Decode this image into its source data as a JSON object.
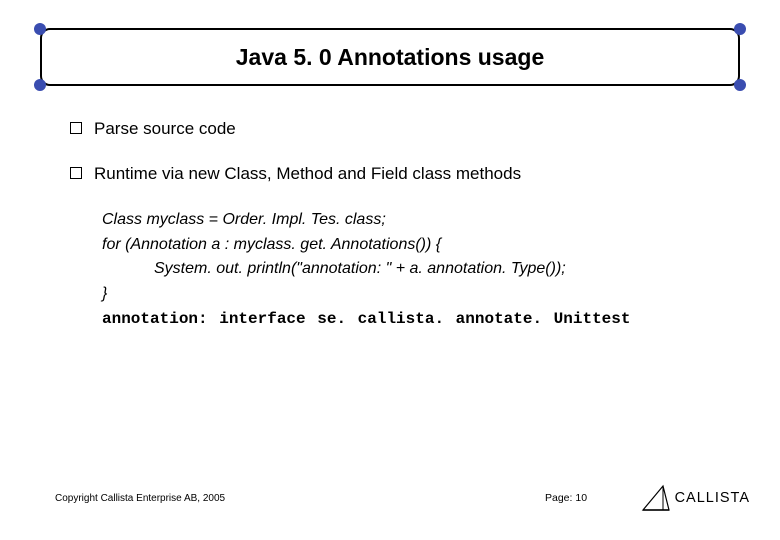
{
  "title": "Java 5. 0 Annotations usage",
  "bullets": [
    "Parse source code",
    "Runtime via new Class, Method and Field class methods"
  ],
  "code": {
    "line1": "Class myclass = Order. Impl. Tes. class;",
    "line2": "for (Annotation a : myclass. get. Annotations()) {",
    "line3": "System. out. println(\"annotation: \" + a. annotation. Type());",
    "line4": "}",
    "line5": "annotation: interface se. callista. annotate. Unittest"
  },
  "footer": {
    "copyright": "Copyright Callista Enterprise AB, 2005",
    "page": "Page: 10",
    "brand": "CALLISTA"
  }
}
